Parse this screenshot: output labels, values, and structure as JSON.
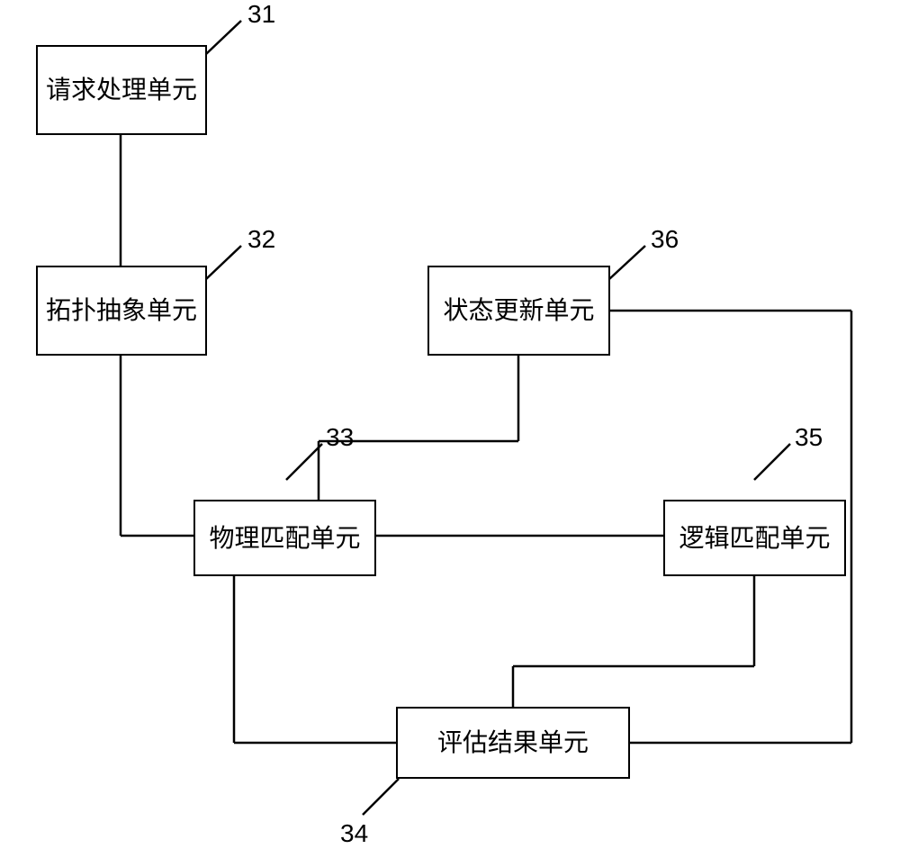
{
  "diagram": {
    "boxes": {
      "request_processing": {
        "label": "请求处理单元",
        "ref": "31"
      },
      "topology_abstraction": {
        "label": "拓扑抽象单元",
        "ref": "32"
      },
      "physical_matching": {
        "label": "物理匹配单元",
        "ref": "33"
      },
      "evaluation_result": {
        "label": "评估结果单元",
        "ref": "34"
      },
      "logical_matching": {
        "label": "逻辑匹配单元",
        "ref": "35"
      },
      "state_update": {
        "label": "状态更新单元",
        "ref": "36"
      }
    }
  }
}
